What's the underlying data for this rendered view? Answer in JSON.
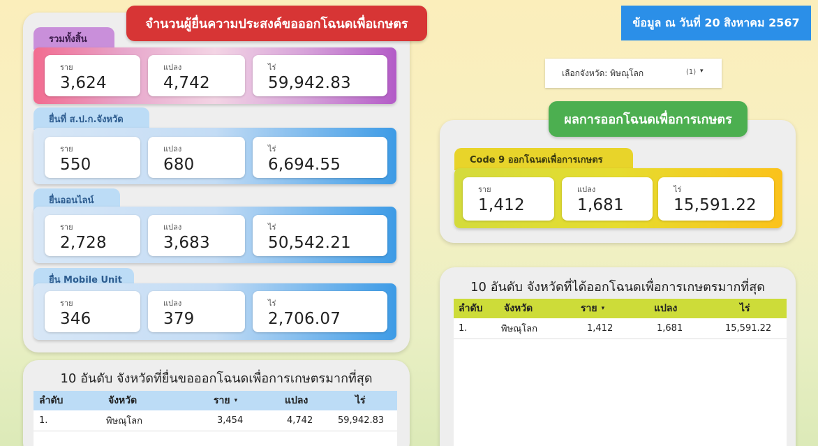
{
  "summary": {
    "title": "จำนวนผู้ยื่นความประสงค์ขอออกโฉนดเพื่อเกษตร",
    "groups": [
      {
        "tab": "รวมทั้งสิ้น",
        "stats": [
          {
            "label": "ราย",
            "value": "3,624"
          },
          {
            "label": "แปลง",
            "value": "4,742"
          },
          {
            "label": "ไร่",
            "value": "59,942.83"
          }
        ]
      },
      {
        "tab": "ยื่นที่ ส.ป.ก.จังหวัด",
        "stats": [
          {
            "label": "ราย",
            "value": "550"
          },
          {
            "label": "แปลง",
            "value": "680"
          },
          {
            "label": "ไร่",
            "value": "6,694.55"
          }
        ]
      },
      {
        "tab": "ยื่นออนไลน์",
        "stats": [
          {
            "label": "ราย",
            "value": "2,728"
          },
          {
            "label": "แปลง",
            "value": "3,683"
          },
          {
            "label": "ไร่",
            "value": "50,542.21"
          }
        ]
      },
      {
        "tab": "ยื่น Mobile Unit",
        "stats": [
          {
            "label": "ราย",
            "value": "346"
          },
          {
            "label": "แปลง",
            "value": "379"
          },
          {
            "label": "ไร่",
            "value": "2,706.07"
          }
        ]
      }
    ]
  },
  "date_badge": "ข้อมูล ณ วันที่ 20 สิงหาคม 2567",
  "province_filter": {
    "label": "เลือกจังหวัด: พิษณุโลก",
    "count": "(1)",
    "caret": "▾"
  },
  "result": {
    "title": "ผลการออกโฉนดเพื่อการเกษตร",
    "tab": "Code 9 ออกโฉนดเพื่อการเกษตร",
    "stats": [
      {
        "label": "ราย",
        "value": "1,412"
      },
      {
        "label": "แปลง",
        "value": "1,681"
      },
      {
        "label": "ไร่",
        "value": "15,591.22"
      }
    ]
  },
  "top_applications": {
    "title": "10 อันดับ จังหวัดที่ยื่นขอออกโฉนดเพื่อการเกษตรมากที่สุด",
    "columns": [
      "ลำดับ",
      "จังหวัด",
      "ราย",
      "แปลง",
      "ไร่"
    ],
    "sort_caret": "▾",
    "rows": [
      {
        "rank": "1.",
        "province": "พิษณุโลก",
        "cases": "3,454",
        "plots": "4,742",
        "rai": "59,942.83"
      }
    ]
  },
  "top_issued": {
    "title": "10 อันดับ จังหวัดที่ได้ออกโฉนดเพื่อการเกษตรมากที่สุด",
    "columns": [
      "ลำดับ",
      "จังหวัด",
      "ราย",
      "แปลง",
      "ไร่"
    ],
    "sort_caret": "▾",
    "rows": [
      {
        "rank": "1.",
        "province": "พิษณุโลก",
        "cases": "1,412",
        "plots": "1,681",
        "rai": "15,591.22"
      }
    ]
  },
  "colors": {
    "title_red": "#d73535",
    "title_green": "#4caf50",
    "date_blue": "#2b8fe8",
    "tab_purple": "#c98fda",
    "tab_blue": "#bcdcf6",
    "tab_yellow": "#e8d42a",
    "table_head_lime": "#cddc39"
  }
}
